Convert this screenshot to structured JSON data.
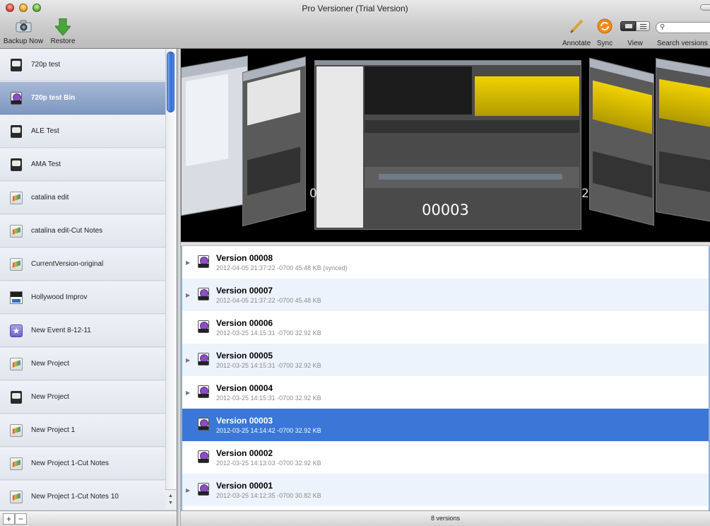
{
  "window": {
    "title": "Pro Versioner (Trial Version)"
  },
  "toolbar": {
    "backup_label": "Backup Now",
    "restore_label": "Restore",
    "annotate_label": "Annotate",
    "sync_label": "Sync",
    "view_label": "View",
    "search_label": "Search versions",
    "search_placeholder": ""
  },
  "sidebar": {
    "items": [
      {
        "label": "720p test",
        "icon": "project-icon"
      },
      {
        "label": "720p test Bin",
        "icon": "bin-icon",
        "selected": true
      },
      {
        "label": "ALE Test",
        "icon": "project-icon"
      },
      {
        "label": "AMA Test",
        "icon": "project-icon"
      },
      {
        "label": "catalina edit",
        "icon": "fcp-project-icon"
      },
      {
        "label": "catalina edit-Cut Notes",
        "icon": "fcp-project-icon"
      },
      {
        "label": "CurrentVersion-original",
        "icon": "fcp-project-icon"
      },
      {
        "label": "Hollywood Improv",
        "icon": "media-icon"
      },
      {
        "label": "New Event 8-12-11",
        "icon": "event-icon"
      },
      {
        "label": "New Project",
        "icon": "fcp-project-icon"
      },
      {
        "label": "New Project",
        "icon": "project-icon"
      },
      {
        "label": "New Project 1",
        "icon": "fcp-project-icon"
      },
      {
        "label": "New Project 1-Cut Notes",
        "icon": "fcp-project-icon"
      },
      {
        "label": "New Project 1-Cut Notes 10",
        "icon": "fcp-project-icon"
      }
    ],
    "add_label": "+",
    "remove_label": "−"
  },
  "preview": {
    "center_caption": "00003",
    "left_caption": "0",
    "right_caption": "2"
  },
  "versions": [
    {
      "name": "Version 00008",
      "meta": "2012-04-05 21:37:22 -0700  45.48 KB (synced)",
      "expandable": true
    },
    {
      "name": "Version 00007",
      "meta": "2012-04-05 21:37:22 -0700  45.48 KB",
      "expandable": true
    },
    {
      "name": "Version 00006",
      "meta": "2012-03-25 14:15:31 -0700  32.92 KB",
      "expandable": false
    },
    {
      "name": "Version 00005",
      "meta": "2012-03-25 14:15:31 -0700  32.92 KB",
      "expandable": true
    },
    {
      "name": "Version 00004",
      "meta": "2012-03-25 14:15:31 -0700  32.92 KB",
      "expandable": true
    },
    {
      "name": "Version 00003",
      "meta": "2012-03-25 14:14:42 -0700  32.92 KB",
      "expandable": false,
      "selected": true
    },
    {
      "name": "Version 00002",
      "meta": "2012-03-25 14:13:03 -0700  32.92 KB",
      "expandable": false
    },
    {
      "name": "Version 00001",
      "meta": "2012-03-25 14:12:35 -0700  30.82 KB",
      "expandable": true
    }
  ],
  "status": {
    "count_label": "8 versions"
  },
  "colors": {
    "selection": "#3a77d6",
    "sidebar_selection": "#8ea4c9",
    "sync_orange": "#f28a1a",
    "restore_green": "#4aa63a"
  }
}
